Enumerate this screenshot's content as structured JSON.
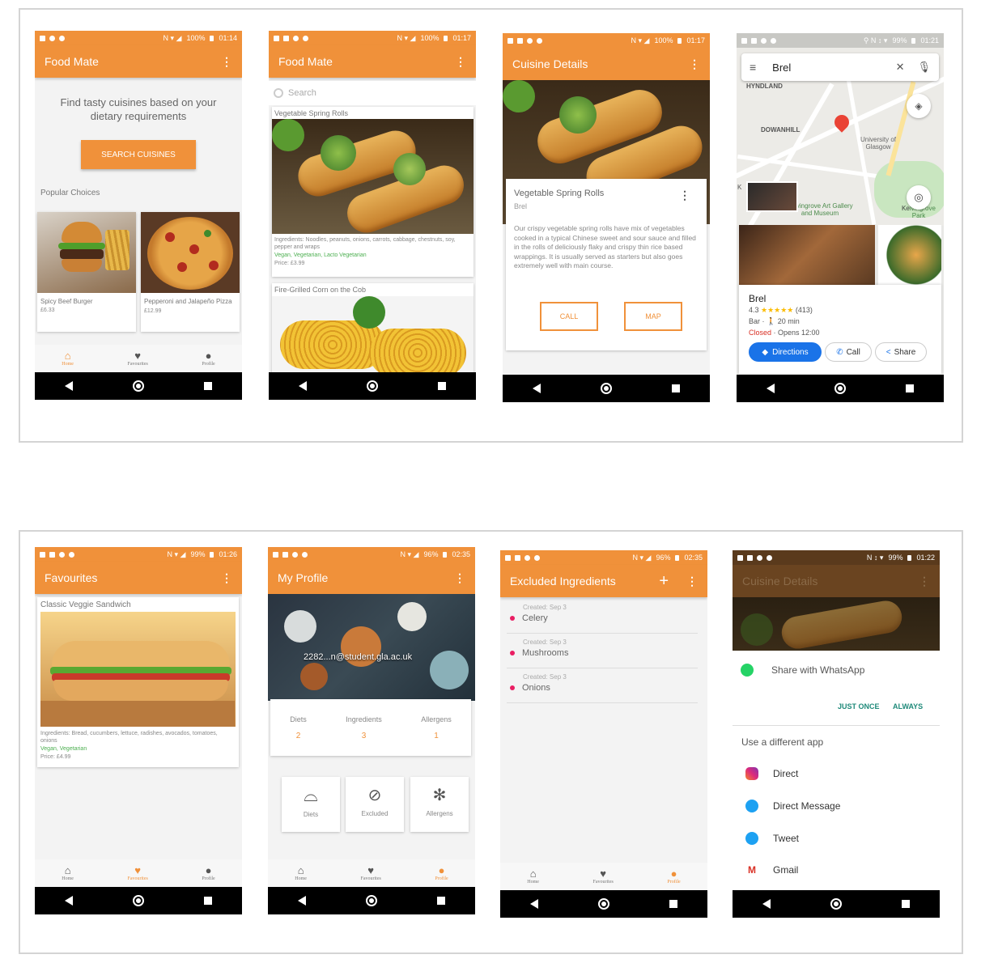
{
  "colors": {
    "accent": "#f0913a",
    "green": "#4caf50",
    "maps_blue": "#1a73e8",
    "closed": "#d93025"
  },
  "status": {
    "s1": {
      "batt": "100%",
      "time": "01:14"
    },
    "s2": {
      "batt": "100%",
      "time": "01:17"
    },
    "s3": {
      "batt": "100%",
      "time": "01:17"
    },
    "s4": {
      "batt": "99%",
      "time": "01:21"
    },
    "s5": {
      "batt": "99%",
      "time": "01:26"
    },
    "s6": {
      "batt": "96%",
      "time": "02:35"
    },
    "s7": {
      "batt": "96%",
      "time": "02:35"
    },
    "s8": {
      "batt": "99%",
      "time": "01:22"
    }
  },
  "nav": {
    "home": "Home",
    "favourites": "Favourites",
    "profile": "Profile"
  },
  "home": {
    "title": "Food Mate",
    "tagline": "Find tasty cuisines based on your dietary requirements",
    "search_btn": "SEARCH CUISINES",
    "popular": "Popular Choices",
    "items": [
      {
        "name": "Spicy Beef Burger",
        "price": "£6.33"
      },
      {
        "name": "Pepperoni and Jalapeño Pizza",
        "price": "£12.99"
      }
    ]
  },
  "search": {
    "title": "Food Mate",
    "placeholder": "Search",
    "card1": {
      "title": "Vegetable Spring Rolls",
      "ingredients": "Ingredients: Noodles, peanuts, onions, carrots, cabbage, chestnuts, soy, pepper and wraps",
      "diets": "Vegan, Vegetarian, Lacto Vegetarian",
      "price": "Price: £3.99"
    },
    "card2": {
      "title": "Fire-Grilled Corn on the Cob"
    }
  },
  "details": {
    "title": "Cuisine Details",
    "name": "Vegetable Spring Rolls",
    "restaurant": "Brel",
    "description": "Our crispy vegetable spring rolls have mix of vegetables cooked in a typical Chinese sweet and sour sauce and filled in the rolls of deliciously flaky and crispy thin rice based wrappings. It is usually served as starters but also goes extremely well with main course.",
    "call": "CALL",
    "map": "MAP"
  },
  "map": {
    "query": "Brel",
    "labels": {
      "hyndland": "HYNDLAND",
      "dowanhill": "DOWANHILL",
      "uni": "University of Glasgow",
      "kelvin": "Kelvingrove Art Gallery and Museum",
      "park": "Kelvingrove Park",
      "k1": "K",
      "ke": "Ke"
    },
    "place": "Brel",
    "rating": "4.3",
    "stars": "★★★★★",
    "reviews": "(413)",
    "type": "Bar",
    "walk": "20 min",
    "closed": "Closed",
    "opens": "Opens 12:00",
    "directions": "Directions",
    "call": "Call",
    "share": "Share"
  },
  "favs": {
    "title": "Favourites",
    "item": "Classic Veggie Sandwich",
    "ingredients": "Ingredients: Bread, cucumbers, lettuce, radishes, avocados, tomatoes, onions",
    "diets": "Vegan, Vegetarian",
    "price": "Price: £4.99"
  },
  "profile": {
    "title": "My Profile",
    "email": "2282...n@student.gla.ac.uk",
    "stats": [
      {
        "label": "Diets",
        "value": "2"
      },
      {
        "label": "Ingredients",
        "value": "3"
      },
      {
        "label": "Allergens",
        "value": "1"
      }
    ],
    "tiles": [
      "Diets",
      "Excluded",
      "Allergens"
    ]
  },
  "excluded": {
    "title": "Excluded Ingredients",
    "items": [
      {
        "created": "Created: Sep 3",
        "name": "Celery"
      },
      {
        "created": "Created: Sep 3",
        "name": "Mushrooms"
      },
      {
        "created": "Created: Sep 3",
        "name": "Onions"
      }
    ]
  },
  "share": {
    "title": "Cuisine Details",
    "whatsapp": "Share with WhatsApp",
    "just_once": "JUST ONCE",
    "always": "ALWAYS",
    "different": "Use a different app",
    "apps": [
      "Direct",
      "Direct Message",
      "Tweet",
      "Gmail"
    ]
  }
}
